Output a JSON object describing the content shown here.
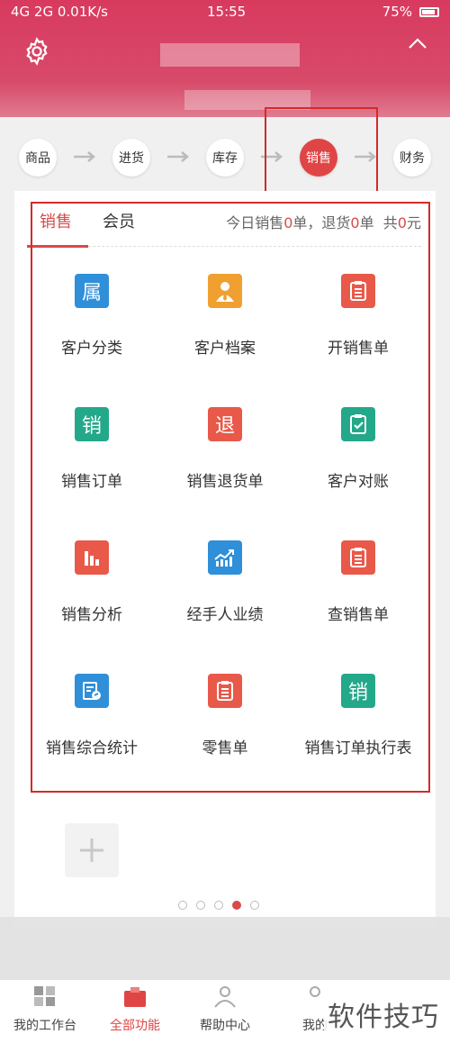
{
  "status_bar": {
    "network": "4G 2G 0.01K/s",
    "time": "15:55",
    "battery": "75%"
  },
  "steps": [
    {
      "label": "商品"
    },
    {
      "label": "进货"
    },
    {
      "label": "库存"
    },
    {
      "label": "销售",
      "active": true
    },
    {
      "label": "财务"
    }
  ],
  "tabs": [
    {
      "label": "销售",
      "active": true
    },
    {
      "label": "会员"
    }
  ],
  "summary": {
    "prefix": "今日销售",
    "sales_count": "0",
    "sep": "单，退货",
    "return_count": "0",
    "unit": "单",
    "total_prefix": "共",
    "total": "0",
    "currency": "元"
  },
  "functions": [
    {
      "label": "客户分类",
      "icon_text": "属",
      "icon": "category-icon",
      "color": "#2f8fd8"
    },
    {
      "label": "客户档案",
      "icon_text": "",
      "icon": "customer-profile-icon",
      "color": "#f0a030"
    },
    {
      "label": "开销售单",
      "icon_text": "",
      "icon": "clipboard-icon",
      "color": "#e8594a"
    },
    {
      "label": "销售订单",
      "icon_text": "销",
      "icon": "sales-order-icon",
      "color": "#23a88a"
    },
    {
      "label": "销售退货单",
      "icon_text": "退",
      "icon": "return-icon",
      "color": "#e8594a"
    },
    {
      "label": "客户对账",
      "icon_text": "",
      "icon": "check-clipboard-icon",
      "color": "#23a88a"
    },
    {
      "label": "销售分析",
      "icon_text": "",
      "icon": "bar-chart-icon",
      "color": "#e8594a"
    },
    {
      "label": "经手人业绩",
      "icon_text": "",
      "icon": "trend-chart-icon",
      "color": "#2f8fd8"
    },
    {
      "label": "查销售单",
      "icon_text": "",
      "icon": "clipboard-icon",
      "color": "#e8594a"
    },
    {
      "label": "销售综合统计",
      "icon_text": "",
      "icon": "stats-doc-icon",
      "color": "#2f8fd8"
    },
    {
      "label": "零售单",
      "icon_text": "",
      "icon": "clipboard-icon",
      "color": "#e8594a"
    },
    {
      "label": "销售订单执行表",
      "icon_text": "销",
      "icon": "order-exec-icon",
      "color": "#23a88a"
    }
  ],
  "pager": {
    "count": 5,
    "active_index": 3
  },
  "bottom_nav": [
    {
      "label": "我的工作台",
      "icon": "workbench-icon"
    },
    {
      "label": "全部功能",
      "icon": "all-functions-icon",
      "active": true
    },
    {
      "label": "帮助中心",
      "icon": "help-icon"
    },
    {
      "label": "我的",
      "icon": "profile-icon"
    }
  ],
  "watermark": "软件技巧",
  "colors": {
    "accent": "#d84a4a",
    "header": "#d83a5e",
    "highlight_border": "#d42a2a"
  }
}
